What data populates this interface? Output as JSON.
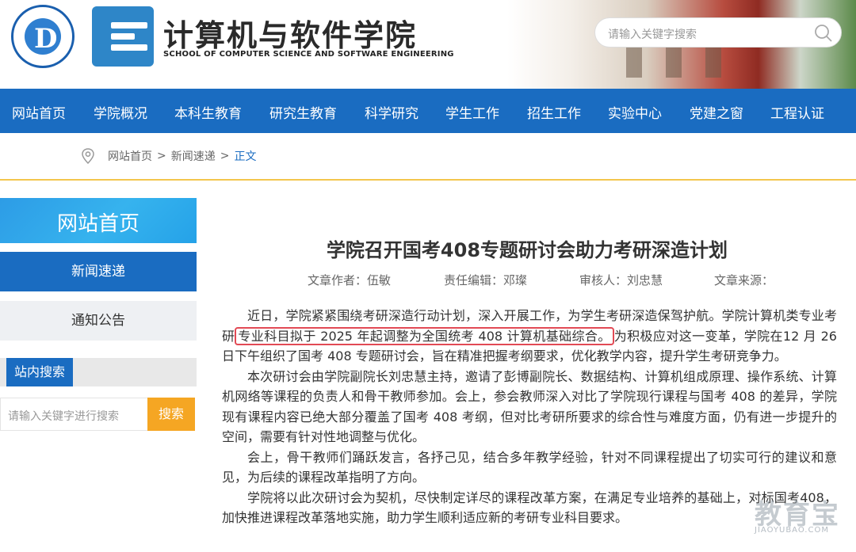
{
  "header": {
    "title_cn": "计算机与软件学院",
    "title_en": "SCHOOL OF COMPUTER SCIENCE AND SOFTWARE ENGINEERING",
    "search_placeholder": "请输入关键字搜索"
  },
  "nav": {
    "items": [
      "网站首页",
      "学院概况",
      "本科生教育",
      "研究生教育",
      "科学研究",
      "学生工作",
      "招生工作",
      "实验中心",
      "党建之窗",
      "工程认证"
    ]
  },
  "breadcrumb": {
    "home": "网站首页",
    "news": "新闻速递",
    "current": "正文",
    "separator": ">"
  },
  "sidebar": {
    "heading": "网站首页",
    "items": [
      {
        "label": "新闻速递",
        "active": true
      },
      {
        "label": "通知公告",
        "active": false
      }
    ],
    "search_heading": "站内搜索",
    "search_placeholder": "请输入关键字进行搜索",
    "search_button": "搜索"
  },
  "article": {
    "title": "学院召开国考408专题研讨会助力考研深造计划",
    "meta": {
      "author": "文章作者：伍敏",
      "editor": "责任编辑：邓璨",
      "reviewer": "审核人：刘忠慧",
      "source": "文章来源："
    },
    "p1_a": "近日，学院紧紧围绕考研深造行动计划，深入开展工作，为学生考研深造保驾护航。学院计算机类专业考研",
    "p1_hl": "专业科目拟于 2025 年起调整为全国统考 408 计算机基础综合。",
    "p1_b": "为积极应对这一变革，学院在12 月 26 日下午组织了国考 408 专题研讨会，旨在精准把握考纲要求，优化教学内容，提升学生考研竞争力。",
    "p2": "本次研讨会由学院副院长刘忠慧主持，邀请了彭博副院长、数据结构、计算机组成原理、操作系统、计算机网络等课程的负责人和骨干教师参加。会上，参会教师深入对比了学院现行课程与国考 408 的差异，学院现有课程内容已绝大部分覆盖了国考 408 考纲，但对比考研所要求的综合性与难度方面，仍有进一步提升的空间，需要有针对性地调整与优化。",
    "p3": "会上，骨干教师们踊跃发言，各抒己见，结合多年教学经验，针对不同课程提出了切实可行的建议和意见，为后续的课程改革指明了方向。",
    "p4": "学院将以此次研讨会为契机，尽快制定详尽的课程改革方案，在满足专业培养的基础上，对标国考408，加快推进课程改革落地实施，助力学生顺利适应新的考研专业科目要求。"
  },
  "watermark": {
    "cn": "教育宝",
    "en": "JIAOYUBAO.COM"
  },
  "colors": {
    "nav_blue": "#1a6cc1",
    "sidebar_blue": "#2d9ce6",
    "accent_orange": "#f5a623",
    "rule_yellow": "#f3c64d",
    "highlight_red": "#e24a55"
  }
}
